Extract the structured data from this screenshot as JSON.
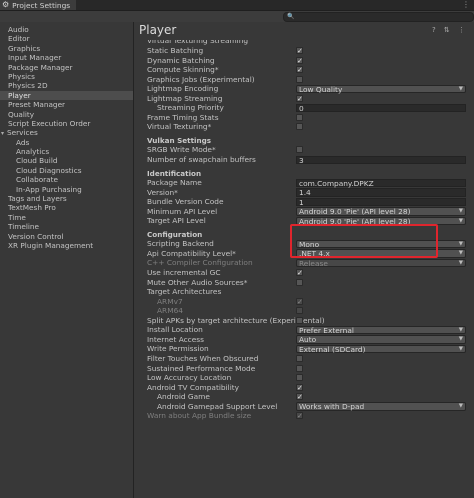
{
  "window": {
    "title": "Project Settings",
    "menu_icon": "kebab-menu-icon",
    "search_placeholder": "🔍"
  },
  "sidebar": {
    "items": [
      {
        "label": "Audio",
        "level": 0
      },
      {
        "label": "Editor",
        "level": 0
      },
      {
        "label": "Graphics",
        "level": 0
      },
      {
        "label": "Input Manager",
        "level": 0
      },
      {
        "label": "Package Manager",
        "level": 0
      },
      {
        "label": "Physics",
        "level": 0
      },
      {
        "label": "Physics 2D",
        "level": 0
      },
      {
        "label": "Player",
        "level": 0,
        "selected": true
      },
      {
        "label": "Preset Manager",
        "level": 0
      },
      {
        "label": "Quality",
        "level": 0
      },
      {
        "label": "Script Execution Order",
        "level": 0
      },
      {
        "label": "Services",
        "level": 0,
        "expanded": true
      },
      {
        "label": "Ads",
        "level": 1
      },
      {
        "label": "Analytics",
        "level": 1
      },
      {
        "label": "Cloud Build",
        "level": 1
      },
      {
        "label": "Cloud Diagnostics",
        "level": 1
      },
      {
        "label": "Collaborate",
        "level": 1
      },
      {
        "label": "In-App Purchasing",
        "level": 1
      },
      {
        "label": "Tags and Layers",
        "level": 0
      },
      {
        "label": "TextMesh Pro",
        "level": 0
      },
      {
        "label": "Time",
        "level": 0
      },
      {
        "label": "Timeline",
        "level": 0
      },
      {
        "label": "Version Control",
        "level": 0
      },
      {
        "label": "XR Plugin Management",
        "level": 0
      }
    ]
  },
  "main": {
    "title": "Player",
    "header_icons": "? ⇅ ⋮",
    "partial_label": "Virtual Texturing Streaming",
    "rows": [
      {
        "label": "Static Batching",
        "type": "check",
        "checked": true
      },
      {
        "label": "Dynamic Batching",
        "type": "check",
        "checked": true
      },
      {
        "label": "Compute Skinning*",
        "type": "check",
        "checked": true
      },
      {
        "label": "Graphics Jobs (Experimental)",
        "type": "check",
        "checked": false
      },
      {
        "label": "Lightmap Encoding",
        "type": "dropdown",
        "value": "Low Quality"
      },
      {
        "label": "Lightmap Streaming",
        "type": "check",
        "checked": true
      },
      {
        "label": "Streaming Priority",
        "type": "field",
        "value": "0",
        "indent": true
      },
      {
        "label": "Frame Timing Stats",
        "type": "check",
        "checked": false
      },
      {
        "label": "Virtual Texturing*",
        "type": "check",
        "checked": false
      },
      {
        "section": "Vulkan Settings"
      },
      {
        "label": "SRGB Write Mode*",
        "type": "check",
        "checked": false
      },
      {
        "label": "Number of swapchain buffers",
        "type": "field",
        "value": "3"
      },
      {
        "section": "Identification"
      },
      {
        "label": "Package Name",
        "type": "field",
        "value": "com.Company.DPKZ"
      },
      {
        "label": "Version*",
        "type": "field",
        "value": "1.4"
      },
      {
        "label": "Bundle Version Code",
        "type": "field",
        "value": "1"
      },
      {
        "label": "Minimum API Level",
        "type": "dropdown",
        "value": "Android 9.0 'Pie' (API level 28)"
      },
      {
        "label": "Target API Level",
        "type": "dropdown",
        "value": "Android 9.0 'Pie' (API level 28)"
      },
      {
        "section": "Configuration"
      },
      {
        "label": "Scripting Backend",
        "type": "dropdown",
        "value": "Mono"
      },
      {
        "label": "Api Compatibility Level*",
        "type": "dropdown",
        "value": ".NET 4.x"
      },
      {
        "label": "C++ Compiler Configuration",
        "type": "dropdown",
        "value": "Release",
        "disabled": true
      },
      {
        "label": "Use incremental GC",
        "type": "check",
        "checked": true
      },
      {
        "label": "Mute Other Audio Sources*",
        "type": "check",
        "checked": false
      },
      {
        "label": "Target Architectures",
        "type": "label"
      },
      {
        "label": "ARMv7",
        "type": "check",
        "checked": true,
        "indent": true,
        "disabled": true
      },
      {
        "label": "ARM64",
        "type": "check",
        "checked": false,
        "indent": true,
        "disabled": true
      },
      {
        "label": "Split APKs by target architecture (Experimental)",
        "type": "check",
        "checked": false
      },
      {
        "label": "Install Location",
        "type": "dropdown",
        "value": "Prefer External"
      },
      {
        "label": "Internet Access",
        "type": "dropdown",
        "value": "Auto"
      },
      {
        "label": "Write Permission",
        "type": "dropdown",
        "value": "External (SDCard)"
      },
      {
        "label": "Filter Touches When Obscured",
        "type": "check",
        "checked": false
      },
      {
        "label": "Sustained Performance Mode",
        "type": "check",
        "checked": false
      },
      {
        "label": "Low Accuracy Location",
        "type": "check",
        "checked": false
      },
      {
        "label": "Android TV Compatibility",
        "type": "check",
        "checked": true
      },
      {
        "label": "Android Game",
        "type": "check",
        "checked": true,
        "indent": true
      },
      {
        "label": "Android Gamepad Support Level",
        "type": "dropdown",
        "value": "Works with D-pad",
        "indent": true
      },
      {
        "label": "Warn about App Bundle size",
        "type": "check",
        "checked": true,
        "disabled": true
      }
    ]
  },
  "highlight_color": "#e0252d"
}
